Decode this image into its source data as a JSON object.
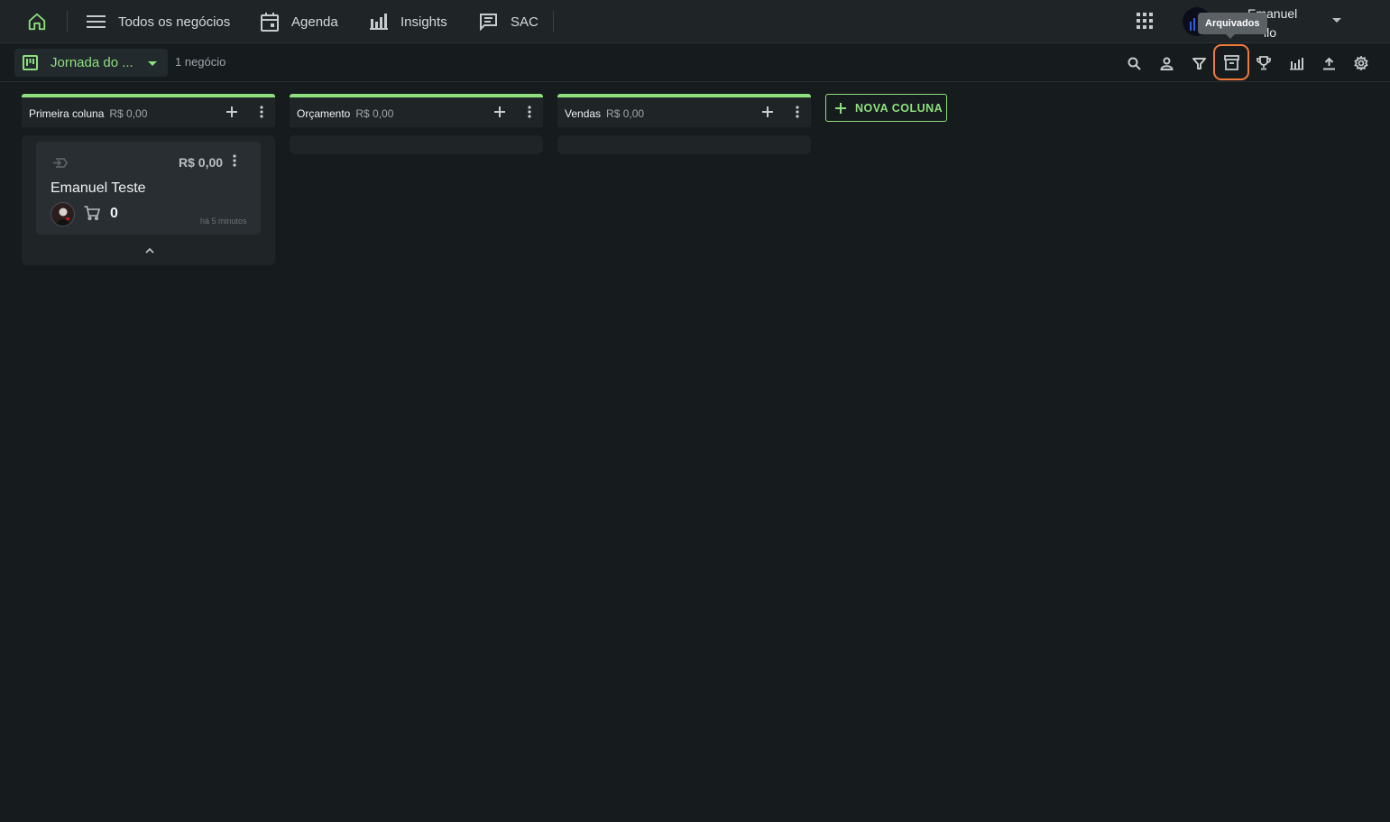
{
  "topbar": {
    "nav": [
      {
        "label": "Todos os negócios",
        "icon": "menu-icon"
      },
      {
        "label": "Agenda",
        "icon": "calendar-icon"
      },
      {
        "label": "Insights",
        "icon": "bar-chart-icon"
      },
      {
        "label": "SAC",
        "icon": "chat-icon"
      }
    ],
    "user": {
      "name_line1": "Emanuel",
      "name_line2": "llo"
    },
    "tooltip": "Arquivados"
  },
  "subbar": {
    "pipeline_label": "Jornada do ...",
    "deal_count": "1 negócio",
    "tools": [
      "search-icon",
      "person-icon",
      "filter-icon",
      "archive-icon",
      "trophy-icon",
      "stats-icon",
      "upload-icon",
      "settings-icon"
    ]
  },
  "board": {
    "columns": [
      {
        "title": "Primeira coluna",
        "total": "R$ 0,00"
      },
      {
        "title": "Orçamento",
        "total": "R$ 0,00"
      },
      {
        "title": "Vendas",
        "total": "R$ 0,00"
      }
    ],
    "card": {
      "value": "R$ 0,00",
      "title": "Emanuel Teste",
      "quantity": "0",
      "time": "há 5 minutos"
    },
    "new_column_label": "NOVA COLUNA"
  },
  "colors": {
    "accent": "#8ee07e",
    "highlight": "#f07a3a",
    "background": "#161b1e",
    "surface": "#1f2427"
  }
}
